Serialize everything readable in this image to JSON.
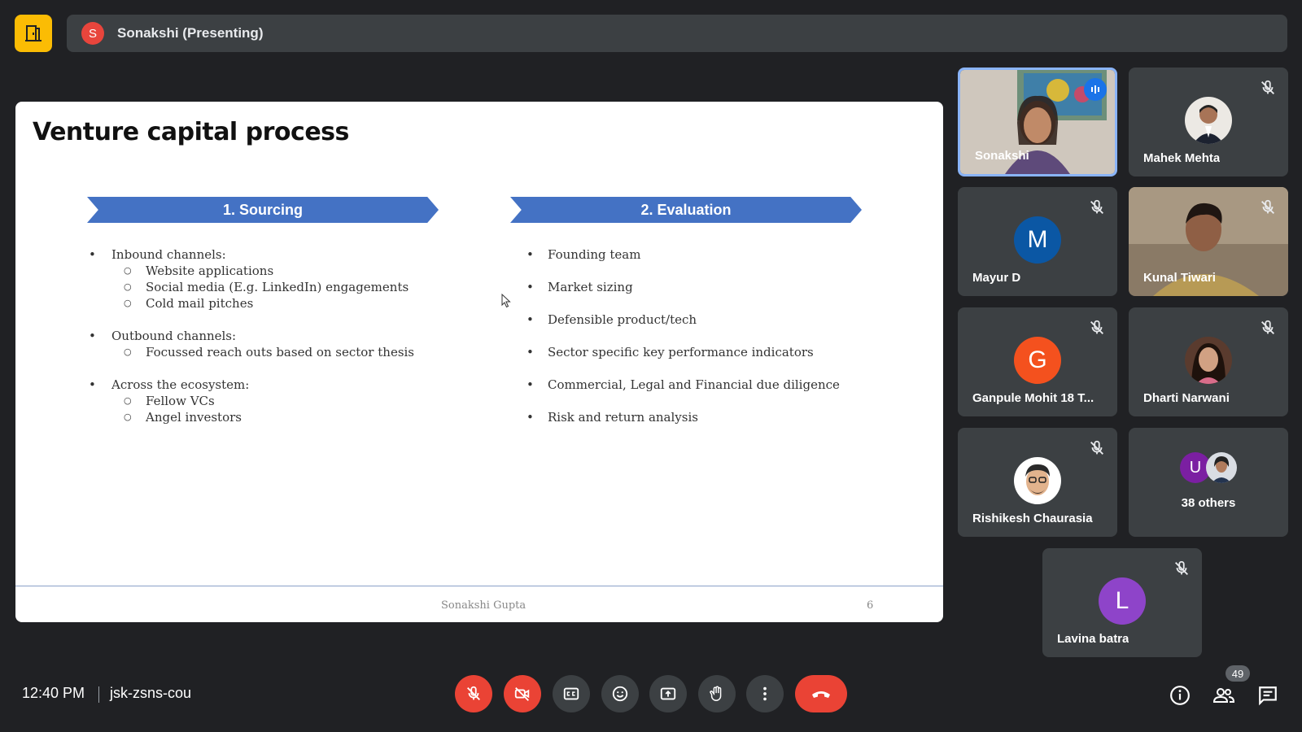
{
  "top_bar": {
    "presenter_initial": "S",
    "presenter_label": "Sonakshi (Presenting)"
  },
  "slide": {
    "title": "Venture capital process",
    "section1": {
      "heading": "1. Sourcing",
      "groups": [
        {
          "label": "Inbound channels:",
          "items": [
            "Website applications",
            "Social media (E.g. LinkedIn) engagements",
            "Cold mail pitches"
          ]
        },
        {
          "label": "Outbound channels:",
          "items": [
            "Focussed reach outs based on sector thesis"
          ]
        },
        {
          "label": "Across the ecosystem:",
          "items": [
            "Fellow VCs",
            "Angel investors"
          ]
        }
      ]
    },
    "section2": {
      "heading": "2. Evaluation",
      "items": [
        "Founding team",
        "Market sizing",
        "Defensible product/tech",
        "Sector specific key performance indicators",
        "Commercial, Legal and Financial due diligence",
        "Risk and return analysis"
      ]
    },
    "footer_name": "Sonakshi Gupta",
    "page_number": "6"
  },
  "participants": [
    {
      "name": "Sonakshi",
      "type": "video",
      "speaking": true
    },
    {
      "name": "Mahek Mehta",
      "type": "photo",
      "muted": true
    },
    {
      "name": "Mayur D",
      "initial": "M",
      "color": "#0b57a4",
      "muted": true
    },
    {
      "name": "Kunal Tiwari",
      "type": "video",
      "muted": true
    },
    {
      "name": "Ganpule Mohit 18 T...",
      "initial": "G",
      "color": "#f4511e",
      "muted": true
    },
    {
      "name": "Dharti Narwani",
      "type": "photo",
      "muted": true
    },
    {
      "name": "Rishikesh Chaurasia",
      "type": "photo",
      "muted": true
    },
    {
      "name": "Lavina batra",
      "initial": "L",
      "color": "#8e44c9",
      "muted": true
    }
  ],
  "others": {
    "label": "38 others",
    "initial": "U",
    "color": "#7b1fa2"
  },
  "bottom_bar": {
    "time": "12:40 PM",
    "meeting_code": "jsk-zsns-cou",
    "people_count": "49"
  },
  "colors": {
    "accent": "#8ab4f8",
    "danger": "#ea4335",
    "chevron": "#4472c4",
    "logo": "#fbbc04"
  }
}
